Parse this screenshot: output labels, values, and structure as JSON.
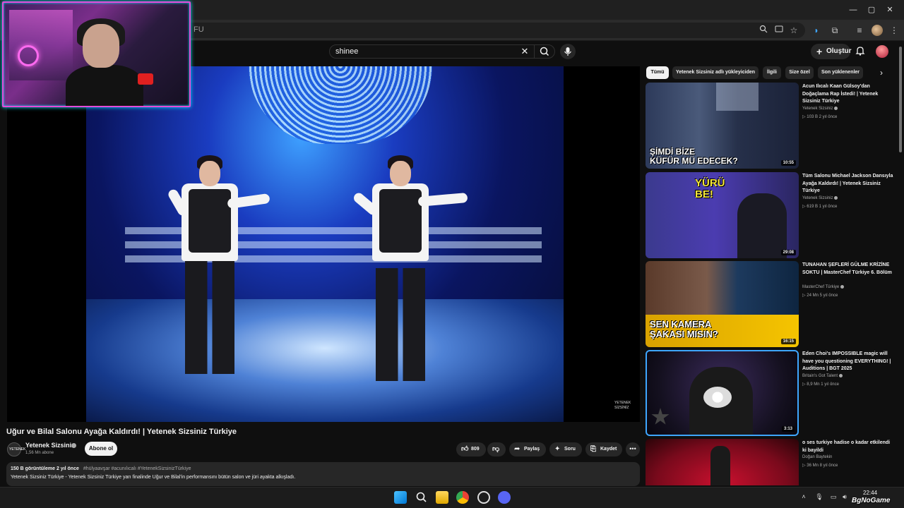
{
  "browser": {
    "url_fragment": "FU"
  },
  "youtube": {
    "search": {
      "value": "shinee"
    },
    "create_label": "Oluştur"
  },
  "video": {
    "title": "Uğur ve Bilal Salonu Ayağa Kaldırdı! | Yetenek Sizsiniz Türkiye",
    "watermark": "YETENEK SİZSİNİZ",
    "channel": {
      "name": "Yetenek Sizsiniz",
      "subscribers": "1,56 Mn abone",
      "avatar_text": "YETENEK"
    },
    "subscribe_label": "Abone ol",
    "actions": {
      "likes": "809",
      "share": "Paylaş",
      "ask": "Soru",
      "save": "Kaydet"
    },
    "description": {
      "views": "150 B görüntüleme",
      "age": "2 yıl önce",
      "tags": "#hülyaavşar #acunılıcalı #YetenekSizsinizTürkiye",
      "text": "Yetenek Sizsiniz Türkiye -  Yetenek Sizsiniz Türkiye yarı finalinde Uğur ve Bilal'in performansını bütün salon ve jüri ayakta alkışladı."
    }
  },
  "chips": [
    "Tümü",
    "Yetenek Sizsiniz adlı yükleyiciden",
    "İlgili",
    "Size özel",
    "Son yüklenenler"
  ],
  "recommendations": [
    {
      "title": "Acun Ilıcalı Kaan Gülsoy'dan Doğaçlama Rap İstedi! | Yetenek Sizsiniz Türkiye",
      "channel": "Yetenek Sizsiniz",
      "meta": "▷ 103 B  2 yıl önce",
      "duration": "10:55",
      "caption": "ŞİMDİ BİZE\nKÜFÜR MÜ EDECEK?"
    },
    {
      "title": "Tüm Salonu Michael Jackson Dansıyla Ayağa Kaldırdı! | Yetenek Sizsiniz Türkiye",
      "channel": "Yetenek Sizsiniz",
      "meta": "▷ 619 B  1 yıl önce",
      "duration": "29:08",
      "caption": "YÜRÜ\nBE!"
    },
    {
      "title": "TUNAHAN ŞEFLERİ GÜLME KRİZİNE SOKTU | MasterChef Türkiye 6. Bölüm",
      "channel": "MasterChef Türkiye",
      "meta": "▷ 24 Mn  5 yıl önce",
      "duration": "16:15",
      "caption": "SEN KAMERA\nŞAKASI MISIN?"
    },
    {
      "title": "Eden Choi's IMPOSSIBLE magic will have you questioning EVERYTHING! | Auditions | BGT 2025",
      "channel": "Britain's Got Talent",
      "meta": "▷ 8,9 Mn  1 yıl önce",
      "duration": "3:13",
      "caption": ""
    },
    {
      "title": "o ses turkiye  hadise o kadar etkilendi ki bayildi",
      "channel": "Doğan Baytekin",
      "meta": "▷ 36 Mn  8 yıl önce",
      "duration": "",
      "caption": ""
    }
  ],
  "taskbar": {
    "time": "22:44",
    "brand": "BgNoGame"
  },
  "colors": {
    "accent_blue": "#3ea6ff",
    "webcam_border": "#e54bd8",
    "background": "#0f0f0f"
  }
}
